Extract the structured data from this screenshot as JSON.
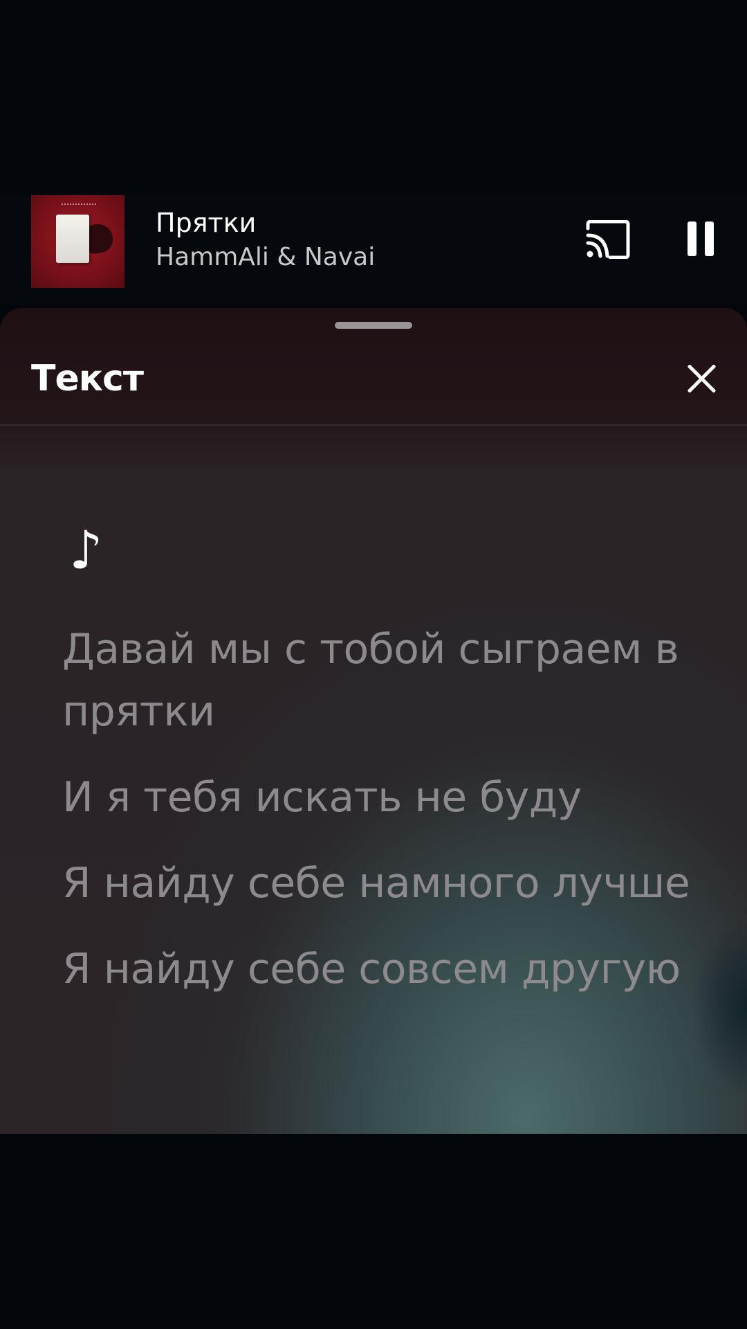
{
  "now_playing": {
    "title": "Прятки",
    "artist": "HammAli & Navai"
  },
  "icons": {
    "cast": "cast-icon",
    "pause": "pause-icon",
    "close": "close-icon",
    "note": "music-note-icon"
  },
  "lyrics_sheet": {
    "title": "Текст",
    "note_glyph": "♪",
    "lines": [
      "Давай мы с тобой сыграем в прятки",
      "И я тебя искать не буду",
      "Я найду себе намного лучше",
      "Я найду себе совсем другую"
    ]
  },
  "colors": {
    "background": "#03070c",
    "sheet_top": "#1f1013",
    "sheet_body": "#2b2528",
    "accent_glow": "#4c6e6c",
    "lyric_text": "#8c8a8c",
    "album_red": "#7a1119"
  }
}
